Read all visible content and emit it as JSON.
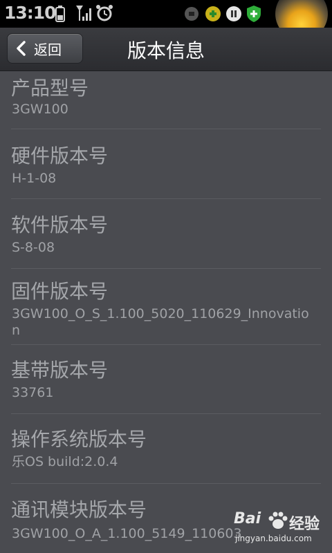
{
  "status_bar": {
    "time": "13:10"
  },
  "header": {
    "back_label": "返回",
    "title": "版本信息"
  },
  "items": [
    {
      "label": "产品型号",
      "value": "3GW100"
    },
    {
      "label": "硬件版本号",
      "value": "H-1-08"
    },
    {
      "label": "软件版本号",
      "value": "S-8-08"
    },
    {
      "label": "固件版本号",
      "value": "3GW100_O_S_1.100_5020_110629_Innovation"
    },
    {
      "label": "基带版本号",
      "value": "33761"
    },
    {
      "label": "操作系统版本号",
      "value": "乐OS build:2.0.4"
    },
    {
      "label": "通讯模块版本号",
      "value": "3GW100_O_A_1.100_5149_110603"
    }
  ],
  "watermark": {
    "brand": "Bai",
    "brand2": "经验",
    "url": "jingyan.baidu.com"
  }
}
